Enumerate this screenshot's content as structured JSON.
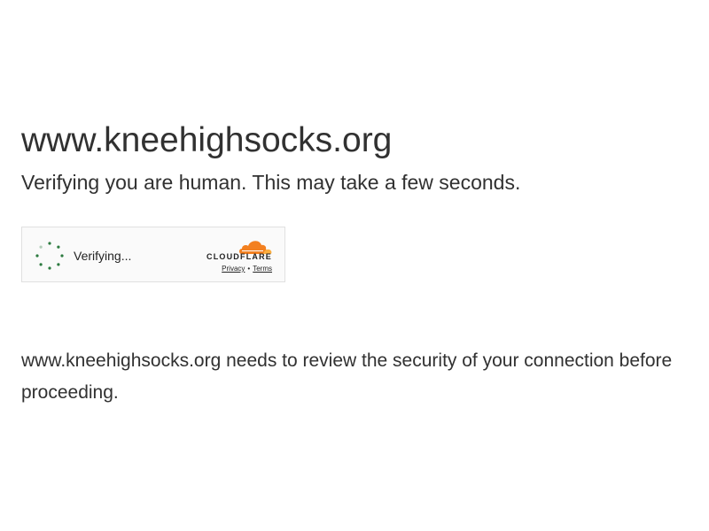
{
  "header": {
    "site_title": "www.kneehighsocks.org",
    "subtitle": "Verifying you are human. This may take a few seconds."
  },
  "challenge_widget": {
    "status_text": "Verifying...",
    "brand_name": "CLOUDFLARE",
    "privacy_link": "Privacy",
    "separator": "•",
    "terms_link": "Terms",
    "spinner_color": "#2c7a3f",
    "brand_orange": "#f38020",
    "brand_light_orange": "#faae40"
  },
  "main": {
    "message": "www.kneehighsocks.org needs to review the security of your connection before proceeding."
  }
}
